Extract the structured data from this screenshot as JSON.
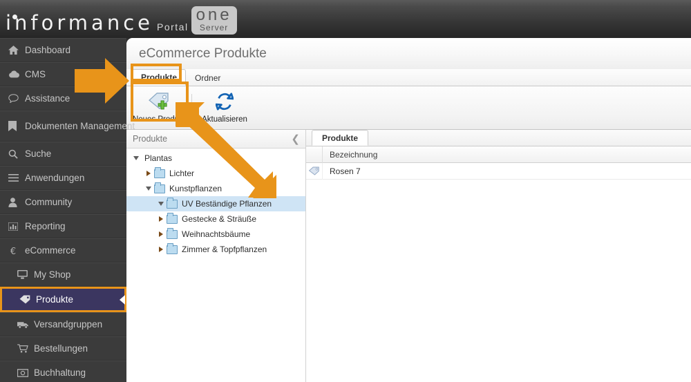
{
  "brand": {
    "name": "informance",
    "portal": "Portal",
    "one": "one",
    "server": "Server",
    "accent_color": "#e8941a",
    "sidebar_bg": "#3b3b3b",
    "active_item_bg": "#3b3660"
  },
  "sidebar": {
    "items": [
      {
        "label": "Dashboard",
        "icon": "home-icon",
        "sub": false,
        "active": false,
        "tall": false
      },
      {
        "label": "CMS",
        "icon": "cloud-icon",
        "sub": false,
        "active": false,
        "tall": false
      },
      {
        "label": "Assistance",
        "icon": "chat-icon",
        "sub": false,
        "active": false,
        "tall": false
      },
      {
        "label": "Dokumenten Management",
        "icon": "bookmark-icon",
        "sub": false,
        "active": false,
        "tall": true
      },
      {
        "label": "Suche",
        "icon": "search-icon",
        "sub": false,
        "active": false,
        "tall": false
      },
      {
        "label": "Anwendungen",
        "icon": "menu-icon",
        "sub": false,
        "active": false,
        "tall": false
      },
      {
        "label": "Community",
        "icon": "user-icon",
        "sub": false,
        "active": false,
        "tall": false
      },
      {
        "label": "Reporting",
        "icon": "chart-icon",
        "sub": false,
        "active": false,
        "tall": false
      },
      {
        "label": "eCommerce",
        "icon": "euro-icon",
        "sub": false,
        "active": false,
        "tall": false
      },
      {
        "label": "My Shop",
        "icon": "monitor-icon",
        "sub": true,
        "active": false,
        "tall": false
      },
      {
        "label": "Produkte",
        "icon": "tag-icon",
        "sub": true,
        "active": true,
        "tall": false
      },
      {
        "label": "Versandgruppen",
        "icon": "truck-icon",
        "sub": true,
        "active": false,
        "tall": false
      },
      {
        "label": "Bestellungen",
        "icon": "cart-icon",
        "sub": true,
        "active": false,
        "tall": false
      },
      {
        "label": "Buchhaltung",
        "icon": "money-icon",
        "sub": true,
        "active": false,
        "tall": false
      }
    ]
  },
  "page": {
    "title": "eCommerce Produkte",
    "tabs": [
      {
        "label": "Produkte",
        "active": true
      },
      {
        "label": "Ordner",
        "active": false
      }
    ],
    "toolbar": [
      {
        "label": "Neues Produkt",
        "icon": "new-product-tag-icon"
      },
      {
        "label": "Aktualisieren",
        "icon": "refresh-icon"
      }
    ]
  },
  "tree": {
    "header": "Produkte",
    "collapse_icon": "chevron-left-icon",
    "nodes": [
      {
        "label": "Plantas",
        "depth": 0,
        "state": "expanded",
        "selected": false,
        "folder": false
      },
      {
        "label": "Lichter",
        "depth": 1,
        "state": "collapsed",
        "selected": false,
        "folder": true
      },
      {
        "label": "Kunstpflanzen",
        "depth": 1,
        "state": "expanded",
        "selected": false,
        "folder": true
      },
      {
        "label": "UV Beständige Pflanzen",
        "depth": 2,
        "state": "expanded",
        "selected": true,
        "folder": true
      },
      {
        "label": "Gestecke & Sträuße",
        "depth": 2,
        "state": "collapsed",
        "selected": false,
        "folder": true
      },
      {
        "label": "Weihnachtsbäume",
        "depth": 2,
        "state": "collapsed",
        "selected": false,
        "folder": true
      },
      {
        "label": "Zimmer & Topfpflanzen",
        "depth": 2,
        "state": "collapsed",
        "selected": false,
        "folder": true
      }
    ]
  },
  "grid": {
    "tab": "Produkte",
    "columns": [
      "Bezeichnung"
    ],
    "rows": [
      {
        "icon": "product-tag-icon",
        "Bezeichnung": "Rosen 7"
      }
    ]
  },
  "annotations": {
    "arrows": [
      {
        "name": "arrow-to-sidebar-produkte",
        "direction": "right"
      },
      {
        "name": "arrow-to-neues-produkt",
        "direction": "up-left"
      }
    ],
    "highlights": [
      {
        "name": "highlight-produkte-tab",
        "target": "Produkte"
      },
      {
        "name": "highlight-neues-produkt",
        "target": "Neues Produkt"
      },
      {
        "name": "highlight-sidebar-produkte",
        "target": "Produkte"
      }
    ]
  }
}
